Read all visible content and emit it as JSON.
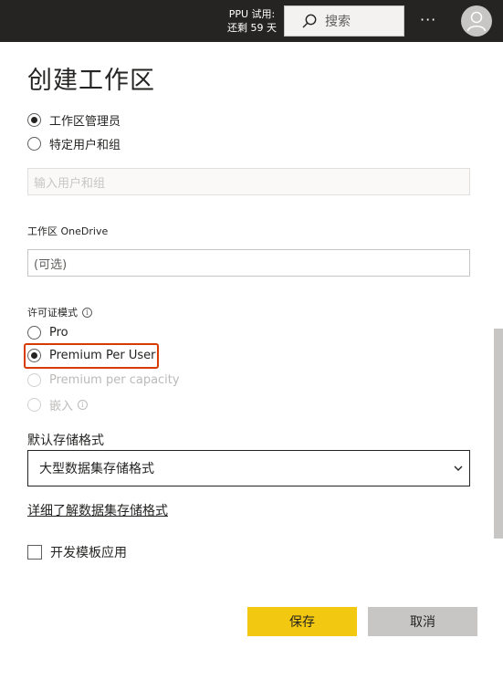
{
  "topbar": {
    "trial_line1": "PPU 试用:",
    "trial_line2": "还剩 59 天",
    "search_placeholder": "搜索",
    "search_icon": "search-icon",
    "more_label": "···",
    "avatar_icon": "user-icon"
  },
  "panel": {
    "title": "创建工作区",
    "admin_options": [
      {
        "label": "工作区管理员",
        "selected": true
      },
      {
        "label": "特定用户和组",
        "selected": false
      }
    ],
    "users_input_placeholder": "输入用户和组",
    "onedrive_label": "工作区 OneDrive",
    "onedrive_placeholder": "(可选)",
    "license_label": "许可证模式",
    "license_info_icon": "info-icon",
    "license_options": [
      {
        "label": "Pro",
        "selected": false,
        "disabled": false
      },
      {
        "label": "Premium Per User",
        "selected": true,
        "disabled": false
      },
      {
        "label": "Premium per capacity",
        "selected": false,
        "disabled": true
      },
      {
        "label": "嵌入",
        "selected": false,
        "disabled": true
      }
    ],
    "storage_label": "默认存储格式",
    "storage_value": "大型数据集存储格式",
    "storage_link": "详细了解数据集存储格式",
    "template_app_label": "开发模板应用",
    "template_app_checked": false
  },
  "footer": {
    "save_label": "保存",
    "cancel_label": "取消"
  },
  "colors": {
    "topbar": "#252423",
    "save_button": "#f2c811",
    "cancel_button": "#c8c6c4",
    "highlight": "#d83b01"
  }
}
